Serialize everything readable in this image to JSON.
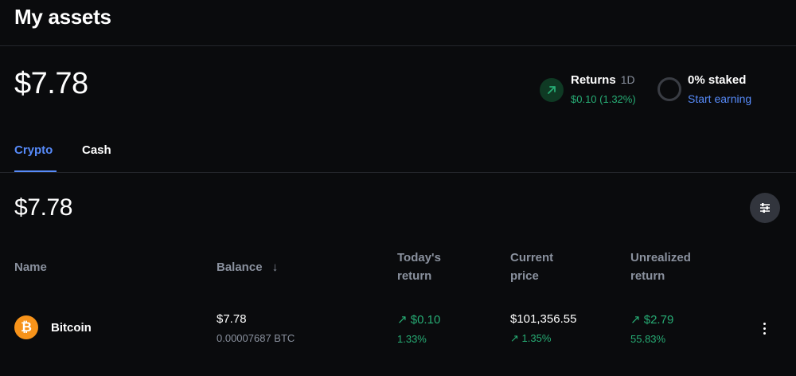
{
  "header": {
    "title": "My assets"
  },
  "portfolio": {
    "total_balance": "$7.78"
  },
  "returns": {
    "label": "Returns",
    "period": "1D",
    "value": "$0.10 (1.32%)",
    "icon": "arrow-up-right-icon"
  },
  "staking": {
    "label": "0% staked",
    "link": "Start earning",
    "icon": "ring-icon"
  },
  "tabs": [
    {
      "label": "Crypto",
      "active": true
    },
    {
      "label": "Cash",
      "active": false
    }
  ],
  "section": {
    "balance": "$7.78",
    "filter_icon": "sliders-icon"
  },
  "table": {
    "columns": {
      "name": "Name",
      "balance": "Balance",
      "balance_sort": "↓",
      "todays_return": [
        "Today's",
        "return"
      ],
      "current_price": [
        "Current",
        "price"
      ],
      "unrealized_return": [
        "Unrealized",
        "return"
      ]
    },
    "rows": [
      {
        "icon": "bitcoin-icon",
        "icon_glyph": "₿",
        "name": "Bitcoin",
        "balance": "$7.78",
        "balance_crypto": "0.00007687 BTC",
        "todays_return_value": "$0.10",
        "todays_return_pct": "1.33%",
        "current_price": "$101,356.55",
        "price_change": "1.35%",
        "unrealized_value": "$2.79",
        "unrealized_pct": "55.83%",
        "menu_icon": "more-vertical-icon"
      }
    ]
  },
  "colors": {
    "background": "#0a0b0d",
    "accent": "#578bfa",
    "positive": "#27ad75",
    "muted": "#8a919e",
    "bitcoin": "#f7931a"
  }
}
